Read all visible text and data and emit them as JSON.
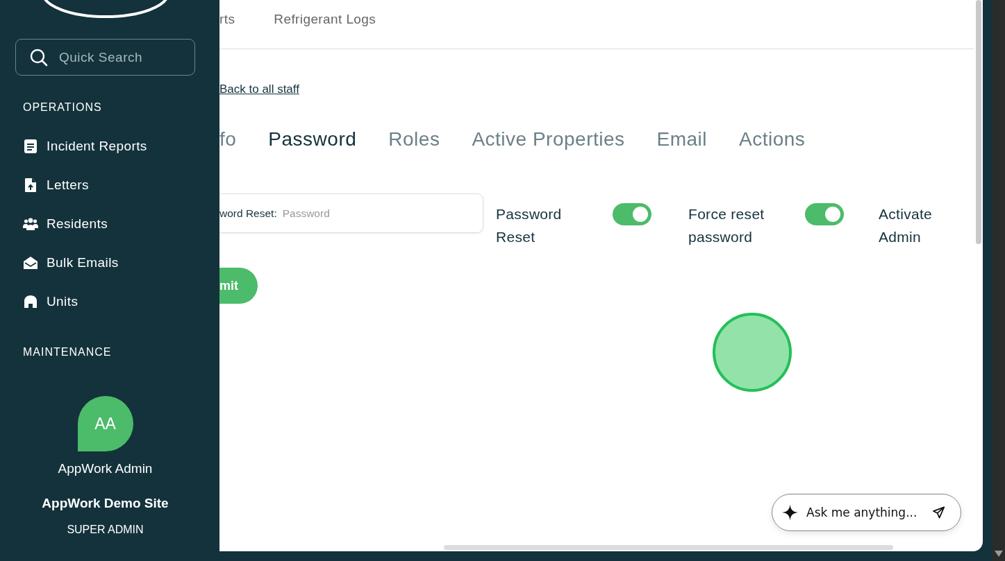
{
  "sidebar": {
    "search": {
      "placeholder": "Quick Search"
    },
    "sections": [
      {
        "title": "OPERATIONS",
        "items": [
          {
            "label": "Incident Reports"
          },
          {
            "label": "Letters"
          },
          {
            "label": "Residents"
          },
          {
            "label": "Bulk Emails"
          },
          {
            "label": "Units"
          }
        ]
      },
      {
        "title": "MAINTENANCE"
      }
    ],
    "user": {
      "initials": "AA",
      "name": "AppWork Admin",
      "site": "AppWork Demo Site",
      "role": "SUPER ADMIN"
    }
  },
  "top_nav": [
    "rts",
    "Refrigerant Logs"
  ],
  "back_link": "Back to all staff",
  "tabs": [
    {
      "label": "fo",
      "selected": false
    },
    {
      "label": "Password",
      "selected": true
    },
    {
      "label": "Roles",
      "selected": false
    },
    {
      "label": "Active Properties",
      "selected": false
    },
    {
      "label": "Email",
      "selected": false
    },
    {
      "label": "Actions",
      "selected": false
    }
  ],
  "password_field": {
    "label": "word Reset:",
    "placeholder": "Password"
  },
  "toggles": [
    {
      "label": "Password Reset",
      "on": true
    },
    {
      "label": "Force reset password",
      "on": true
    },
    {
      "label": "Activate Admin"
    }
  ],
  "submit_button": "mit",
  "chat": {
    "placeholder": "Ask me anything..."
  }
}
